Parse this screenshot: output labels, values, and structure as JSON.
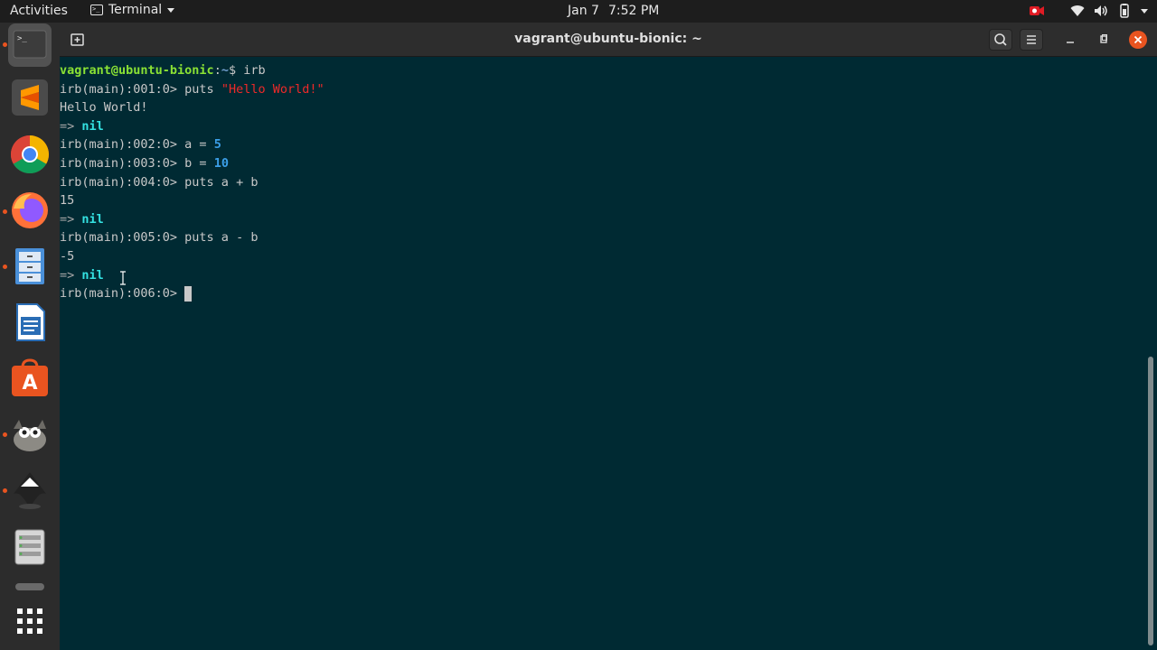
{
  "topbar": {
    "activities": "Activities",
    "app_name": "Terminal",
    "date": "Jan 7",
    "time": "7:52 PM"
  },
  "dock": {
    "items": [
      {
        "name": "terminal",
        "active": true
      },
      {
        "name": "sublime-text"
      },
      {
        "name": "chrome"
      },
      {
        "name": "firefox"
      },
      {
        "name": "files"
      },
      {
        "name": "libreoffice-writer"
      },
      {
        "name": "ubuntu-software"
      },
      {
        "name": "gimp"
      },
      {
        "name": "inkscape"
      },
      {
        "name": "show-applications"
      }
    ]
  },
  "window": {
    "title": "vagrant@ubuntu-bionic: ~"
  },
  "terminal": {
    "line1": {
      "user": "vagrant@ubuntu-bionic",
      "sep": ":",
      "path": "~",
      "cmd": "$ irb"
    },
    "line2": {
      "prompt": "irb(main):001:0> ",
      "cmd": "puts ",
      "str": "\"Hello World!\""
    },
    "line3": {
      "text": "Hello World!"
    },
    "line4": {
      "arrow": "=> ",
      "nil": "nil"
    },
    "line5": {
      "prompt": "irb(main):002:0> ",
      "cmd": "a = ",
      "num": "5"
    },
    "line6": {
      "prompt": "irb(main):003:0> ",
      "cmd": "b = ",
      "num": "10"
    },
    "line7": {
      "prompt": "irb(main):004:0> ",
      "cmd": "puts a + b"
    },
    "line8": {
      "text": "15"
    },
    "line9": {
      "arrow": "=> ",
      "nil": "nil"
    },
    "line10": {
      "prompt": "irb(main):005:0> ",
      "cmd": "puts a - b"
    },
    "line11": {
      "text": "-5"
    },
    "line12": {
      "arrow": "=> ",
      "nil": "nil"
    },
    "line13": {
      "prompt": "irb(main):006:0> "
    }
  },
  "colors": {
    "terminal_bg": "#002a33",
    "accent": "#e95420"
  }
}
